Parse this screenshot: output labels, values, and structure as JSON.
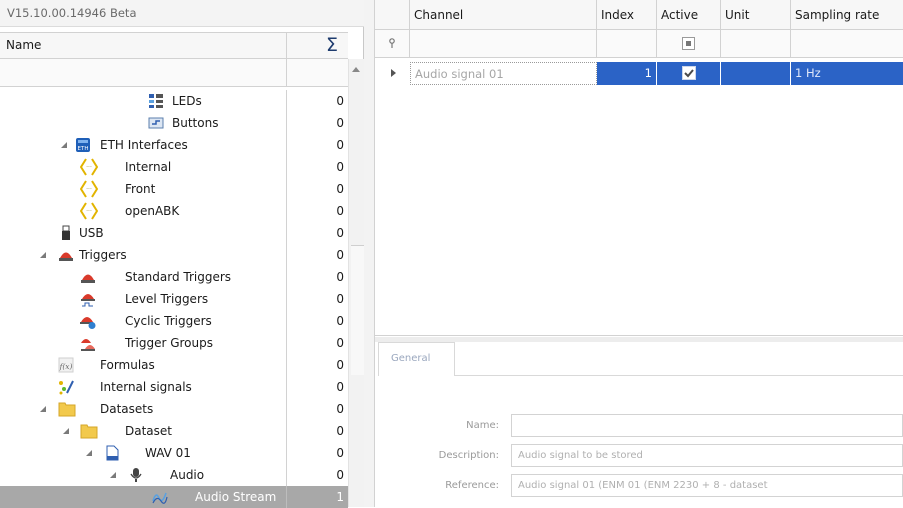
{
  "app": {
    "version": "V15.10.00.14946 Beta"
  },
  "tree": {
    "header_name": "Name",
    "header_sum": "Σ",
    "rows": [
      {
        "label": "LEDs",
        "count": "0",
        "icon": "leds-icon"
      },
      {
        "label": "Buttons",
        "count": "0",
        "icon": "buttons-icon"
      },
      {
        "label": "ETH Interfaces",
        "count": "0",
        "icon": "eth-interfaces-icon"
      },
      {
        "label": "Internal",
        "count": "0",
        "icon": "interface-bracket-icon"
      },
      {
        "label": "Front",
        "count": "0",
        "icon": "interface-bracket-icon"
      },
      {
        "label": "openABK",
        "count": "0",
        "icon": "interface-bracket-icon"
      },
      {
        "label": "USB",
        "count": "0",
        "icon": "usb-icon"
      },
      {
        "label": "Triggers",
        "count": "0",
        "icon": "trigger-icon"
      },
      {
        "label": "Standard Triggers",
        "count": "0",
        "icon": "standard-trigger-icon"
      },
      {
        "label": "Level Triggers",
        "count": "0",
        "icon": "level-trigger-icon"
      },
      {
        "label": "Cyclic Triggers",
        "count": "0",
        "icon": "cyclic-trigger-icon"
      },
      {
        "label": "Trigger Groups",
        "count": "0",
        "icon": "trigger-group-icon"
      },
      {
        "label": "Formulas",
        "count": "0",
        "icon": "formula-icon"
      },
      {
        "label": "Internal signals",
        "count": "0",
        "icon": "internal-signals-icon"
      },
      {
        "label": "Datasets",
        "count": "0",
        "icon": "folder-icon"
      },
      {
        "label": "Dataset",
        "count": "0",
        "icon": "folder-icon"
      },
      {
        "label": "WAV 01",
        "count": "0",
        "icon": "wav-file-icon"
      },
      {
        "label": "Audio",
        "count": "0",
        "icon": "microphone-icon"
      },
      {
        "label": "Audio Stream",
        "count": "1",
        "icon": "audio-stream-icon"
      }
    ]
  },
  "grid": {
    "columns": [
      "Channel",
      "Index",
      "Active",
      "Unit",
      "Sampling rate"
    ],
    "rows": [
      {
        "channel": "Audio signal 01",
        "index": "1",
        "active": true,
        "unit": "",
        "sampling_rate": "1 Hz"
      }
    ]
  },
  "details": {
    "tab": "General",
    "fields": [
      {
        "label": "Name:",
        "value": ""
      },
      {
        "label": "Description:",
        "value": "Audio signal to be stored"
      },
      {
        "label": "Reference:",
        "value": "Audio signal 01 (ENM 01 (ENM 2230 + 8 - dataset"
      }
    ]
  },
  "colors": {
    "selection_blue": "#2b63c6",
    "tree_selected": "#a8a8a8",
    "sigma": "#1d3b6e"
  }
}
